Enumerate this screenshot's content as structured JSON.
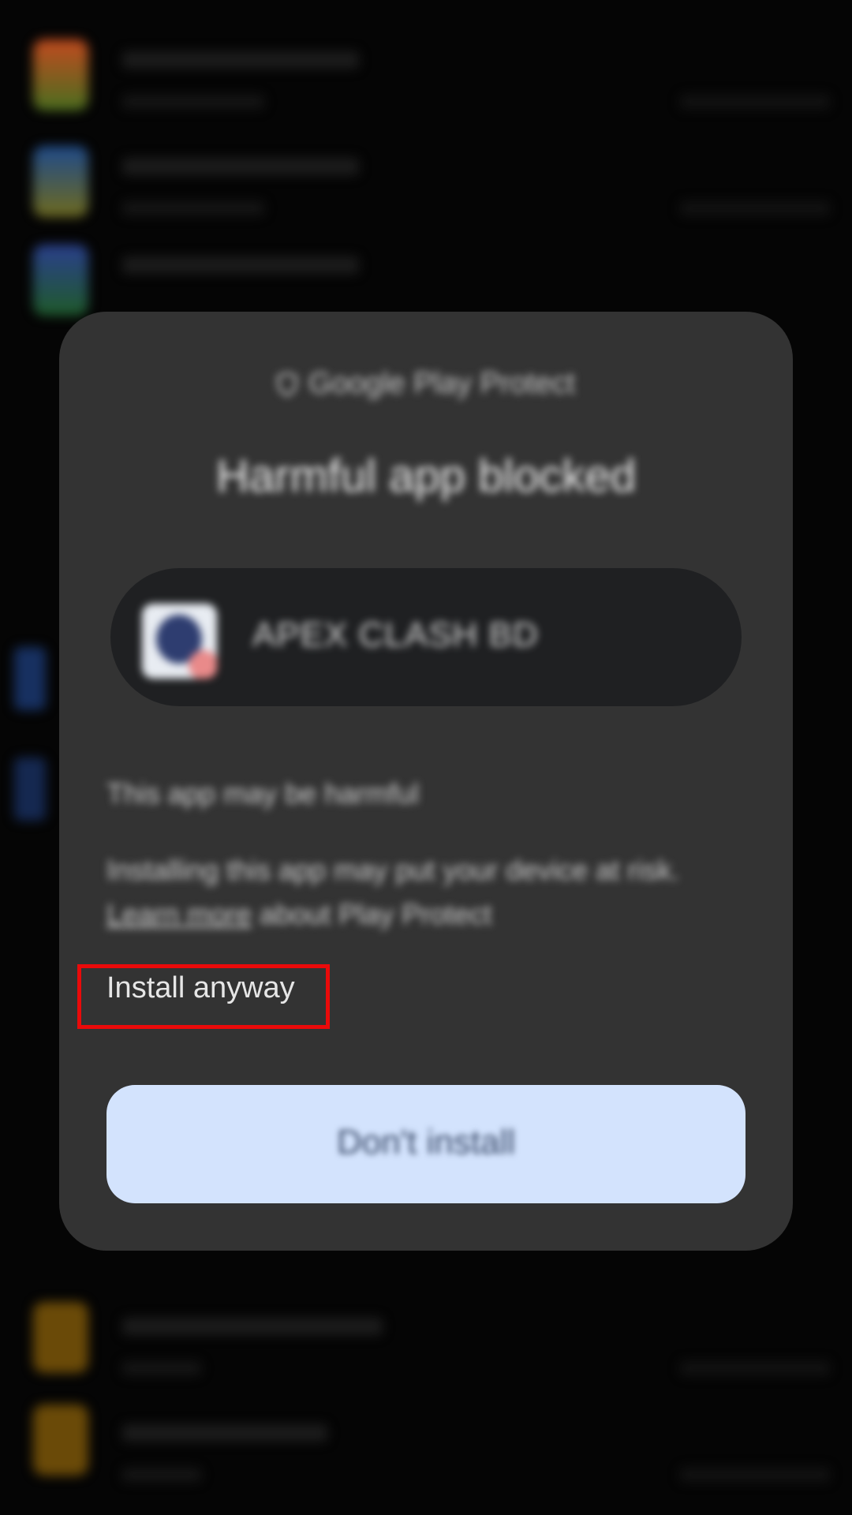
{
  "dialog": {
    "header": "Google Play Protect",
    "title": "Harmful app blocked",
    "app_name": "APEX CLASH BD",
    "warning_short": "This app may be harmful",
    "warning_long": "Installing this app may put your device at risk.",
    "learn_more": "Learn more",
    "learn_more_suffix": "about Play Protect",
    "install_anyway_label": "Install anyway",
    "primary_button_label": "Don't install"
  },
  "colors": {
    "dialog_bg": "#333333",
    "primary_button_bg": "#d3e3fd",
    "highlight_border": "#ea0a0a"
  }
}
